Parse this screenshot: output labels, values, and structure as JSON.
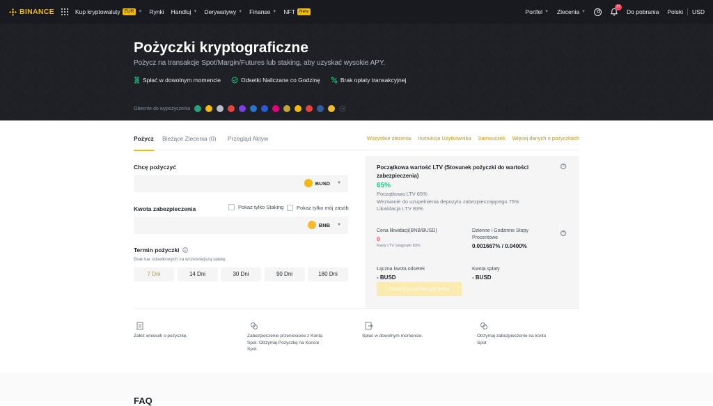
{
  "nav": {
    "brand": "BINANCE",
    "items": [
      {
        "label": "Kup kryptowaluty",
        "badge": "EUR",
        "caret": true
      },
      {
        "label": "Rynki"
      },
      {
        "label": "Handluj",
        "caret": true
      },
      {
        "label": "Derywatywy",
        "caret": true
      },
      {
        "label": "Finanse",
        "caret": true
      },
      {
        "label": "NFT",
        "badge": "New"
      }
    ],
    "right": {
      "wallet": "Portfel",
      "orders": "Zlecenia",
      "notifications": "37",
      "download": "Do pobrania",
      "language": "Polski",
      "currency": "USD"
    }
  },
  "hero": {
    "title": "Pożyczki kryptograficzne",
    "subtitle": "Pożycz na transakcje Spot/Margin/Futures lub staking, aby uzyskać wysokie APY.",
    "features": [
      "Spłać w dowolnym momencie",
      "Odsetki Naliczane co Godzinę",
      "Brak opłaty transakcyjnej"
    ],
    "coins_label": "Obecnie do wypożyczenia",
    "coin_colors": [
      "#26a17b",
      "#f0b90b",
      "#b7bdc6",
      "#e84142",
      "#7b3fe4",
      "#2775ca",
      "#2a5ada",
      "#e6007a",
      "#c2a633",
      "#f0b90b",
      "#e84142",
      "#345d9d",
      "#f3ba2f"
    ]
  },
  "tabs": {
    "items": [
      "Pożycz",
      "Bieżące Zlecenia (0)",
      "Przegląd Aktyw"
    ],
    "links": [
      "Wszystkie zlecenia",
      "Instrukcja Użytkownika",
      "Samouczek",
      "Więcej danych o pożyczkach"
    ]
  },
  "form": {
    "borrow_label": "Chcę pożyczyć",
    "borrow_coin": "BUSD",
    "collateral_label": "Kwota zabezpieczenia",
    "check_staking": "Pokaż tylko Staking",
    "check_assets": "Pokaż tylko mój zasób",
    "collateral_coin": "BNB",
    "term_label": "Termin pożyczki",
    "term_hint": "Brak kar odsetkowych za wcześniejszą spłatę.",
    "days": [
      "7 Dni",
      "14 Dni",
      "30 Dni",
      "90 Dni",
      "180 Dni"
    ]
  },
  "panel": {
    "ltv_title": "Początkowa wartość LTV (Stosunek pożyczki do wartości zabezpieczenia)",
    "ltv_value": "65%",
    "ltv_initial": "Początkowa LTV 65%",
    "ltv_margin_call": "Wezwanie do uzupełnienia depozytu zabezpieczającego 75%",
    "ltv_liquidation": "Likwidacja LTV 83%",
    "liq_price_label": "Cena likwidacji(BNB/BUSD)",
    "liq_price_value": "0",
    "liq_price_note": "Kiedy LTV osiągnęło 83%",
    "rate_label": "Dzienne i Godzinne Stopy Procentowe",
    "rate_value": "0.001667% / 0.0400%",
    "interest_label": "Łączna kwota odsetek",
    "interest_value": "- BUSD",
    "repay_label": "Kwota spłaty",
    "repay_value": "- BUSD",
    "button": "Zacznij pożyczać już teraz"
  },
  "steps": [
    "Załóż wniosek o pożyczkę.",
    "Zabezpieczenie przeniesione z Konta Spot. Otrzymaj Pożyczkę na Koncie Spot.",
    "Spłać w dowolnym momencie.",
    "Otrzymaj zabezpieczenie na konto Spot"
  ],
  "faq_title": "FAQ"
}
